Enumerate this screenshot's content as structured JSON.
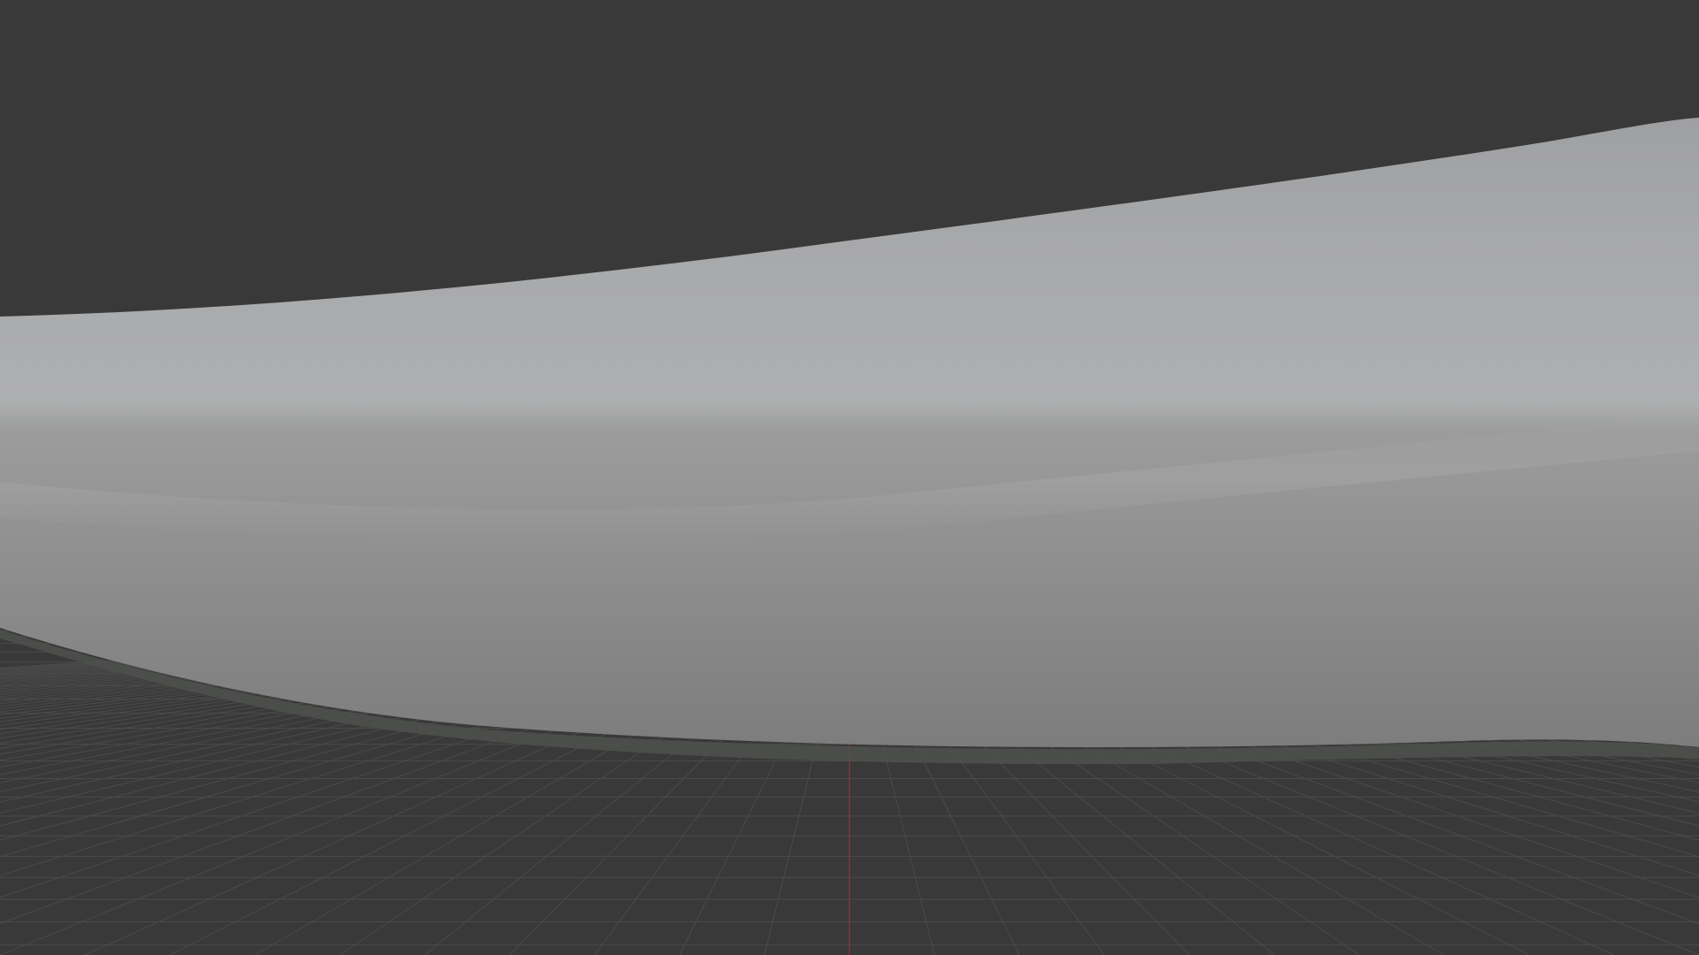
{
  "viewport": {
    "background_color": "#393939",
    "grid_line_color": "#4a4a4a",
    "axis_x_color": "#9a3540",
    "object_light_color": "#a9aaac",
    "object_dark_color": "#7f807f",
    "object_edge_color": "#565853",
    "shading": "solid"
  }
}
